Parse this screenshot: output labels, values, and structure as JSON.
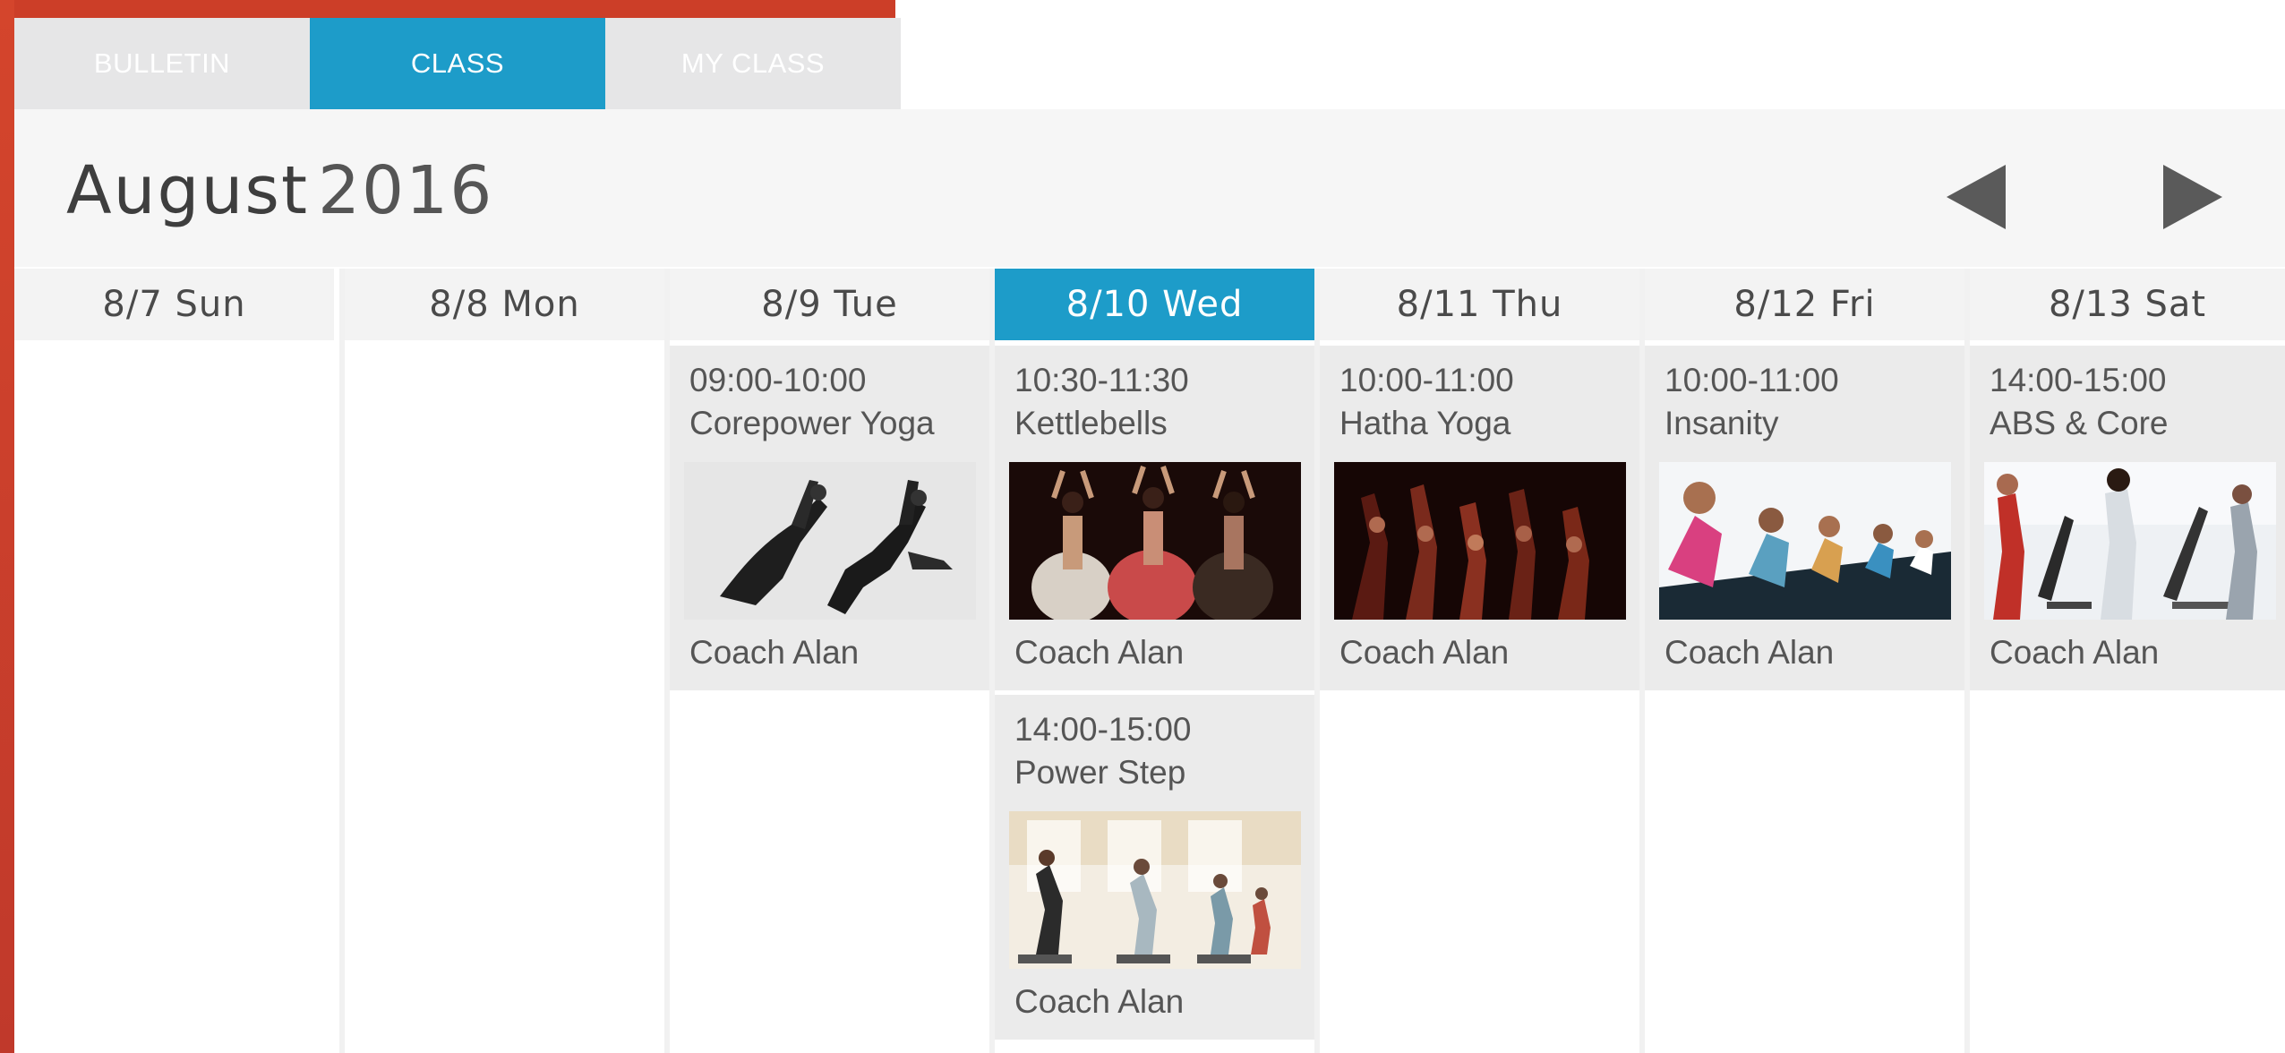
{
  "tabs": [
    {
      "label": "BULLETIN",
      "active": false
    },
    {
      "label": "CLASS",
      "active": true
    },
    {
      "label": "MY CLASS",
      "active": false
    }
  ],
  "header": {
    "month": "August",
    "year": "2016",
    "prev_icon": "triangle-left-icon",
    "next_icon": "triangle-right-icon"
  },
  "colors": {
    "accent": "#1d9cc9",
    "brand_red": "#cc3e28",
    "session_bg": "#ebebeb",
    "tab_inactive": "#e6e6e7"
  },
  "days": [
    {
      "label": "8/7 Sun",
      "today": false,
      "sessions": []
    },
    {
      "label": "8/8 Mon",
      "today": false,
      "sessions": []
    },
    {
      "label": "8/9 Tue",
      "today": false,
      "sessions": [
        {
          "time": "09:00-10:00",
          "name": "Corepower Yoga",
          "coach": "Coach Alan",
          "photo": "dancers-bw-photo"
        }
      ]
    },
    {
      "label": "8/10 Wed",
      "today": true,
      "sessions": [
        {
          "time": "10:30-11:30",
          "name": "Kettlebells",
          "coach": "Coach Alan",
          "photo": "flamenco-dancers-photo"
        },
        {
          "time": "14:00-15:00",
          "name": "Power Step",
          "coach": "Coach Alan",
          "photo": "step-class-photo"
        }
      ]
    },
    {
      "label": "8/11 Thu",
      "today": false,
      "sessions": [
        {
          "time": "10:00-11:00",
          "name": "Hatha Yoga",
          "coach": "Coach Alan",
          "photo": "stage-dancers-photo"
        }
      ]
    },
    {
      "label": "8/12 Fri",
      "today": false,
      "sessions": [
        {
          "time": "10:00-11:00",
          "name": "Insanity",
          "coach": "Coach Alan",
          "photo": "spin-class-photo"
        }
      ]
    },
    {
      "label": "8/13 Sat",
      "today": false,
      "sessions": [
        {
          "time": "14:00-15:00",
          "name": "ABS & Core",
          "coach": "Coach Alan",
          "photo": "elliptical-gym-photo"
        }
      ]
    }
  ]
}
